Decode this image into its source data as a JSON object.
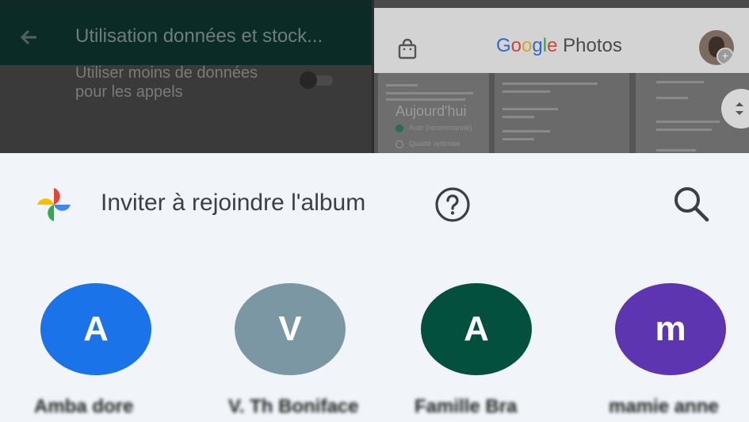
{
  "background_left": {
    "title": "Utilisation données et stock...",
    "setting_label": "Utiliser moins de données pour les appels",
    "colors": {
      "appbar": "#0b2b27",
      "body": "#3a3a3a"
    }
  },
  "background_right": {
    "logo_google": "Google",
    "logo_photos": "Photos",
    "today_label": "Aujourd'hui",
    "options": [
      "Auto (recommandé)",
      "Qualité optimale"
    ],
    "colors": {
      "topbar": "#d3d3d3"
    }
  },
  "sheet": {
    "title": "Inviter à rejoindre l'album",
    "icons": {
      "app": "google-photos-pinwheel-icon",
      "help": "help-circle-icon",
      "search": "search-icon"
    },
    "contacts": [
      {
        "initial": "A",
        "name": "Amba dore",
        "color": "#1a73e8"
      },
      {
        "initial": "V",
        "name": "V. Th Boniface",
        "color": "#7b97a3"
      },
      {
        "initial": "A",
        "name": "Famille Bra",
        "color": "#03503f"
      },
      {
        "initial": "m",
        "name": "mamie anne",
        "color": "#5e35b1"
      }
    ]
  }
}
